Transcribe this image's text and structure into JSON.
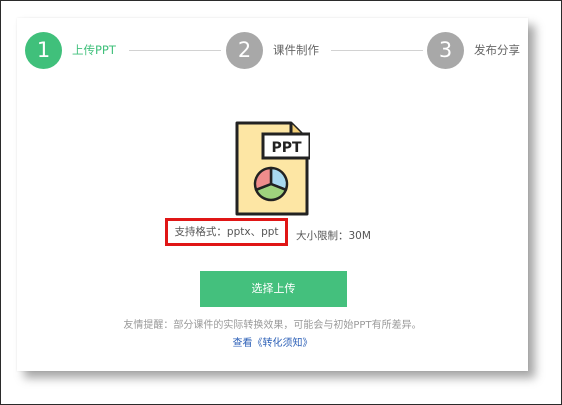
{
  "colors": {
    "active": "#40c07b",
    "inactive": "#a8a8a8",
    "button": "#44c07d",
    "highlight_border": "#e01616",
    "link": "#2f62b8"
  },
  "steps": [
    {
      "number": "1",
      "label": "上传PPT",
      "state": "active"
    },
    {
      "number": "2",
      "label": "课件制作",
      "state": "inactive"
    },
    {
      "number": "3",
      "label": "发布分享",
      "state": "inactive"
    }
  ],
  "file_icon": {
    "icon": "ppt-file-icon",
    "badge": "PPT"
  },
  "info": {
    "formats": "支持格式：pptx、ppt",
    "size_limit": "大小限制：30M"
  },
  "upload_button": {
    "label": "选择上传"
  },
  "tip": "友情提醒：部分课件的实际转换效果，可能会与初始PPT有所差异。",
  "notice_link": "查看《转化须知》"
}
